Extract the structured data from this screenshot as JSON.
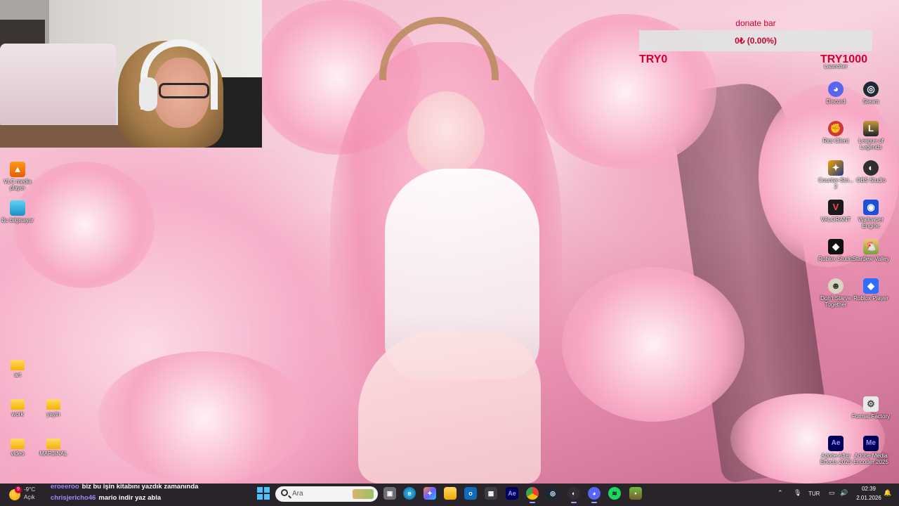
{
  "donate_bar": {
    "title": "donate bar",
    "amount": "0₺ (0.00%)",
    "min_label": "TRY0",
    "max_label": "TRY1000",
    "progress_fraction": 0.0
  },
  "desktop_left": [
    {
      "label": "VLC media player",
      "icon": "vlc-icon"
    },
    {
      "label": "Bu bilgisayar",
      "icon": "computer-icon"
    },
    {
      "label": "art",
      "icon": "folder-icon"
    },
    {
      "label": "work",
      "icon": "folder-icon"
    },
    {
      "label": "yayin",
      "icon": "folder-icon"
    },
    {
      "label": "video",
      "icon": "folder-icon"
    },
    {
      "label": "MARJINAL",
      "icon": "folder-icon"
    }
  ],
  "desktop_right": [
    {
      "label": "Launcher",
      "icon": "launcher-icon"
    },
    {
      "label": "Discord",
      "icon": "discord-icon"
    },
    {
      "label": "Steam",
      "icon": "steam-icon"
    },
    {
      "label": "Riot Client",
      "icon": "riot-icon"
    },
    {
      "label": "League of Legends",
      "icon": "league-icon"
    },
    {
      "label": "Counter-Stri... 2",
      "icon": "cs2-icon"
    },
    {
      "label": "OBS Studio",
      "icon": "obs-icon"
    },
    {
      "label": "VALORANT",
      "icon": "valorant-icon"
    },
    {
      "label": "Wallpaper Engine",
      "icon": "wallpaper-engine-icon"
    },
    {
      "label": "Roblox Studio",
      "icon": "roblox-studio-icon"
    },
    {
      "label": "Stardew Valley",
      "icon": "stardew-icon"
    },
    {
      "label": "Don't Starve Together",
      "icon": "dst-icon"
    },
    {
      "label": "Roblox Player",
      "icon": "roblox-player-icon"
    },
    {
      "label": "Format Factory",
      "icon": "format-factory-icon"
    },
    {
      "label": "Adobe After Effects 2025",
      "icon": "after-effects-icon"
    },
    {
      "label": "Adobe Media Encoder 2025",
      "icon": "media-encoder-icon"
    }
  ],
  "taskbar": {
    "weather_temp": "-9°C",
    "weather_desc": "Açık",
    "notification_count": "9",
    "search_placeholder": "Ara",
    "language": "TUR",
    "time": "02:39",
    "date": "2.01.2026",
    "apps": [
      "start",
      "search",
      "task-view",
      "edge",
      "copilot",
      "file-explorer",
      "outlook",
      "store",
      "after-effects",
      "chrome",
      "steam",
      "obs",
      "discord",
      "spotify",
      "minecraft"
    ]
  },
  "chat": [
    {
      "user": "eroeeroo",
      "message": "biz bu işin kitabını yazdık zamanında"
    },
    {
      "user": "chrisjericho46",
      "message": "mario indir yaz abla"
    }
  ]
}
